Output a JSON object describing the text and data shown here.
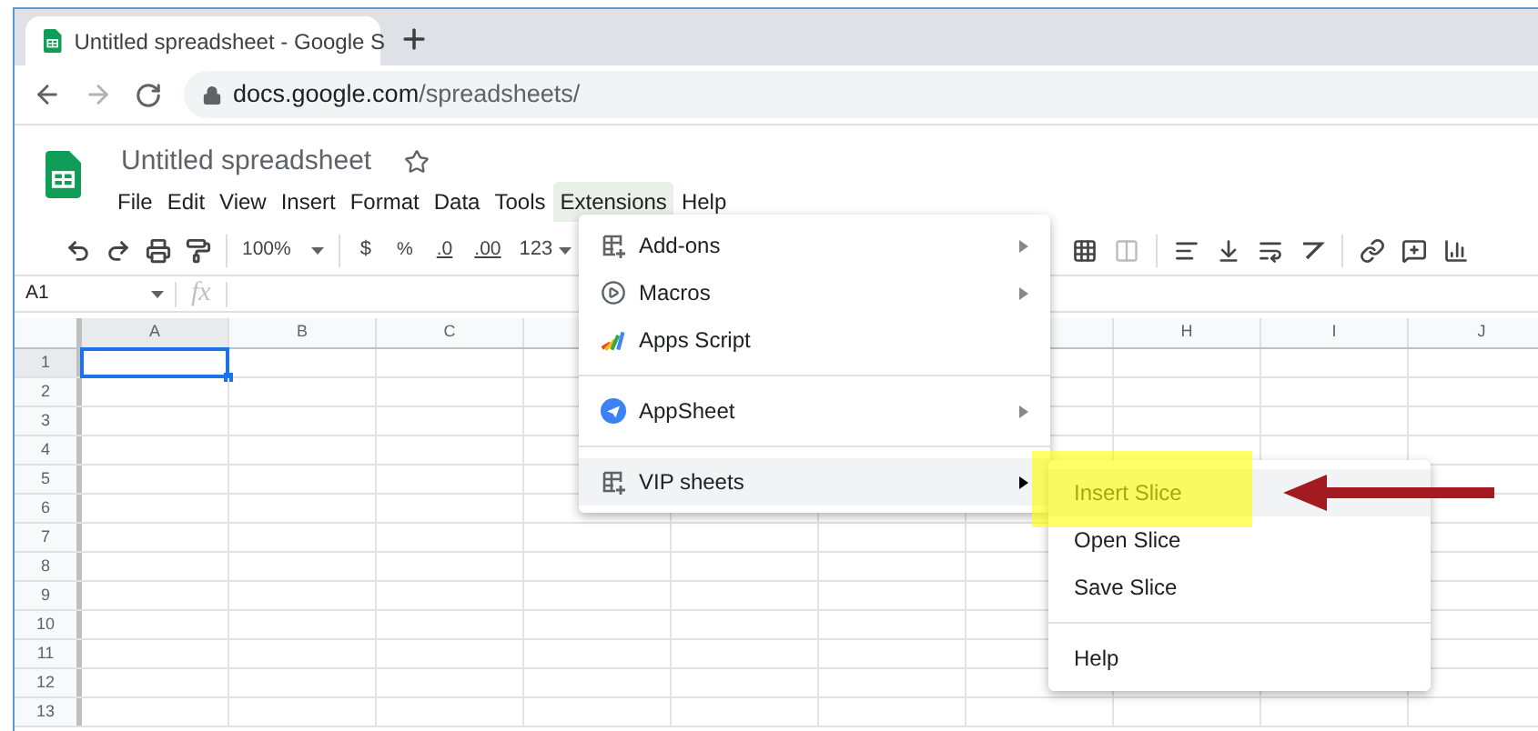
{
  "browser": {
    "tab_title": "Untitled spreadsheet - Google S",
    "url_host": "docs.google.com",
    "url_path": "/spreadsheets/"
  },
  "document": {
    "title": "Untitled spreadsheet"
  },
  "menu_bar": [
    {
      "label": "File",
      "selected": false
    },
    {
      "label": "Edit",
      "selected": false
    },
    {
      "label": "View",
      "selected": false
    },
    {
      "label": "Insert",
      "selected": false
    },
    {
      "label": "Format",
      "selected": false
    },
    {
      "label": "Data",
      "selected": false
    },
    {
      "label": "Tools",
      "selected": false
    },
    {
      "label": "Extensions",
      "selected": true
    },
    {
      "label": "Help",
      "selected": false
    }
  ],
  "toolbar": {
    "zoom": "100%",
    "currency": "$",
    "percent": "%",
    "decrease_decimals": ".0",
    "increase_decimals": ".00",
    "number_format": "123"
  },
  "name_box": "A1",
  "formula_label": "fx",
  "columns": [
    {
      "label": "A"
    },
    {
      "label": "B"
    },
    {
      "label": "C"
    },
    {},
    {},
    {},
    {},
    {
      "label": "H"
    },
    {
      "label": "I"
    },
    {
      "label": "J"
    }
  ],
  "rows": [
    "1",
    "2",
    "3",
    "4",
    "5",
    "6",
    "7",
    "8",
    "9",
    "10",
    "11",
    "12",
    "13"
  ],
  "extensions_menu": [
    {
      "kind": "item",
      "label": "Add-ons",
      "has_submenu": true,
      "selected": false
    },
    {
      "kind": "item",
      "label": "Macros",
      "has_submenu": true,
      "selected": false
    },
    {
      "kind": "item",
      "label": "Apps Script",
      "has_submenu": false,
      "selected": false
    },
    {
      "kind": "divider"
    },
    {
      "kind": "item",
      "label": "AppSheet",
      "has_submenu": true,
      "selected": false
    },
    {
      "kind": "divider"
    },
    {
      "kind": "item",
      "label": "VIP sheets",
      "has_submenu": true,
      "selected": true
    }
  ],
  "submenu": [
    {
      "kind": "item",
      "label": "Insert Slice",
      "selected": true
    },
    {
      "kind": "item",
      "label": "Open Slice",
      "selected": false
    },
    {
      "kind": "item",
      "label": "Save Slice",
      "selected": false
    },
    {
      "kind": "divider"
    },
    {
      "kind": "item",
      "label": "Help",
      "selected": false
    }
  ]
}
